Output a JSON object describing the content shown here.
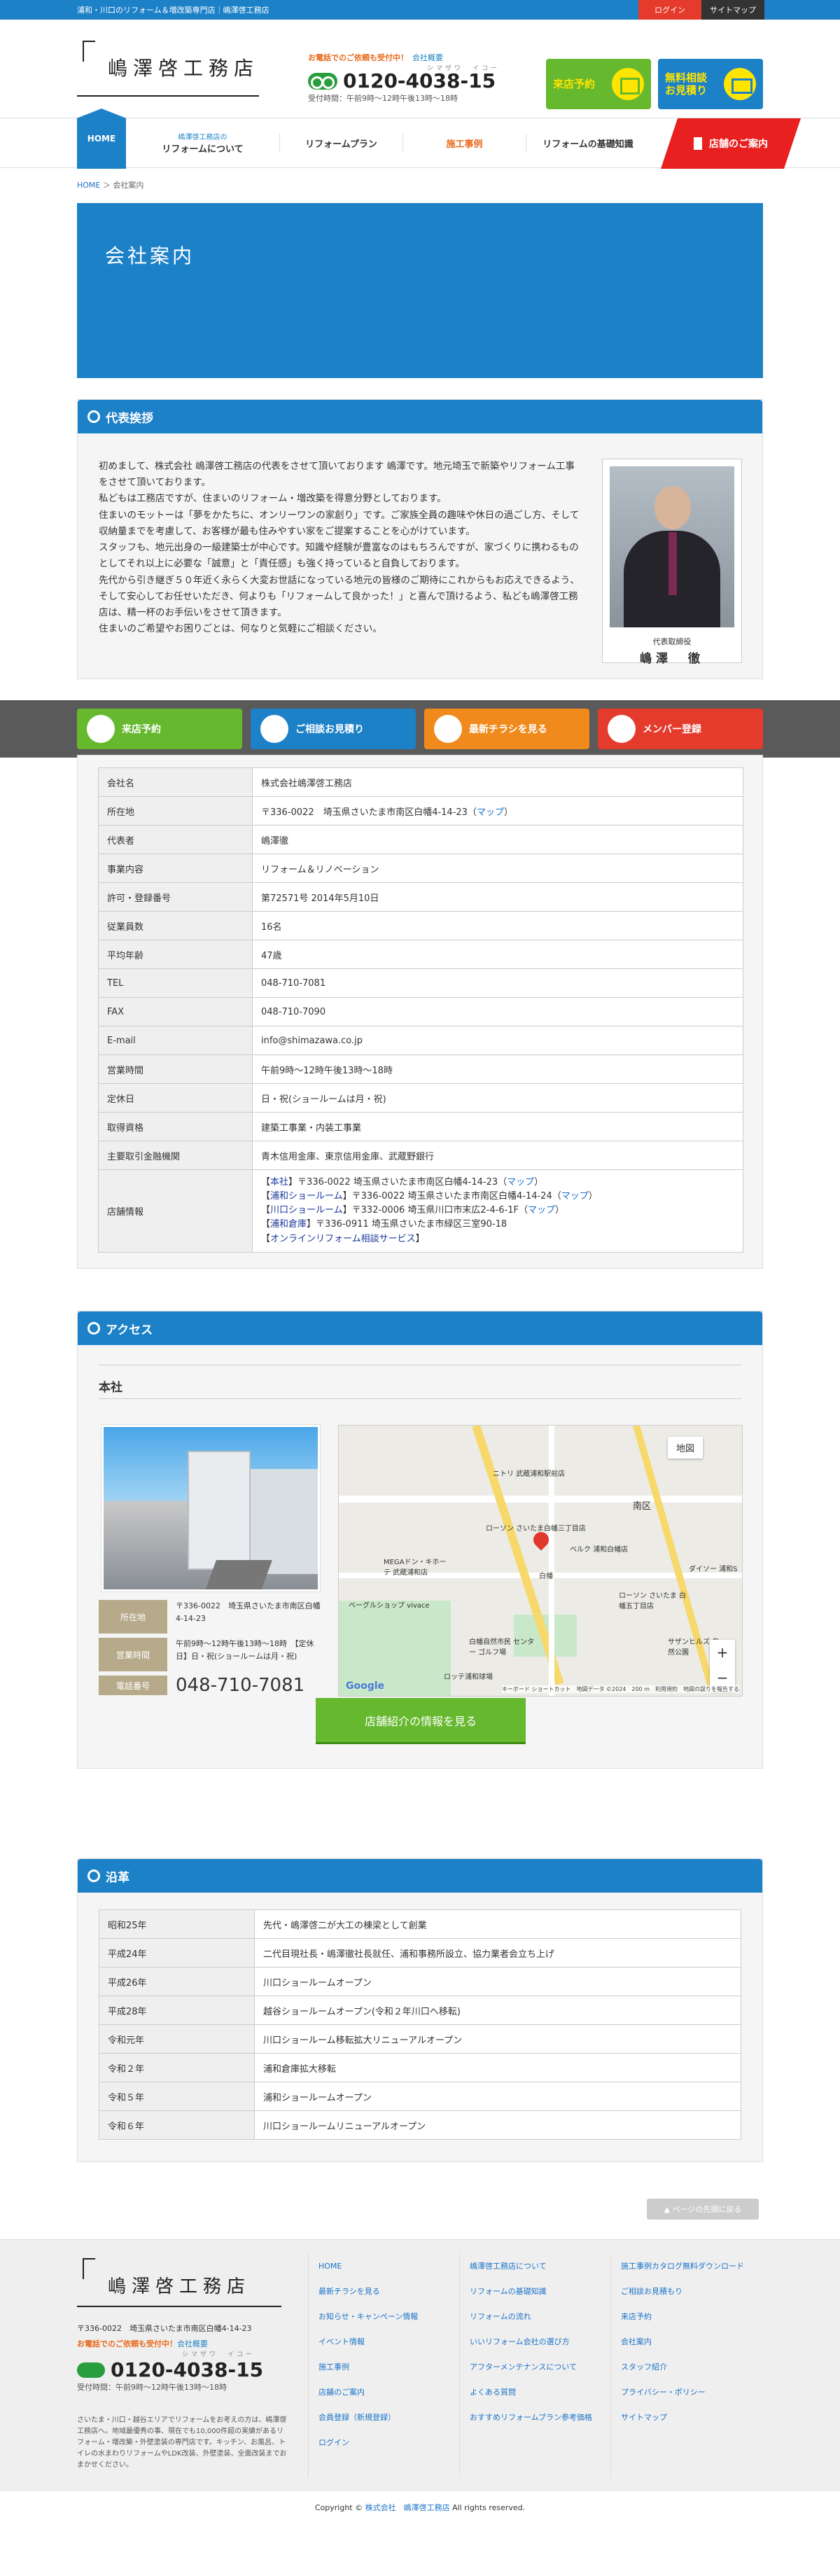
{
  "topbar": {
    "text": "浦和・川口のリフォーム＆増改築専門店｜嶋澤啓工務店",
    "login": "ログイン",
    "sitemap": "サイトマップ"
  },
  "header": {
    "logo": "嶋澤啓工務店",
    "phone_caption": "お電話でのご依頼も受付中！",
    "phone_sub": "会社概要",
    "phone_kana": "シマザワ　イコー",
    "phone_number": "0120-4038-15",
    "hours": "受付時間：午前9時〜12時午後13時〜18時",
    "btn_visit": "来店予約",
    "btn_est": "無料相談\nお見積り"
  },
  "nav": {
    "home": "HOME",
    "about_small": "嶋澤啓工務店の",
    "about": "リフォームについて",
    "plan": "リフォームプラン",
    "cases": "施工事例",
    "basics": "リフォームの基礎知識",
    "shop": "店舗のご案内"
  },
  "breadcrumb": {
    "home": "HOME",
    "sep": "＞",
    "current": "会社案内"
  },
  "page_title": "会社案内",
  "greeting": {
    "heading": "代表挨拶",
    "paragraphs": [
      "初めまして、株式会社 嶋澤啓工務店の代表をさせて頂いております 嶋澤です。地元埼玉で新築やリフォーム工事をさせて頂いております。",
      "私どもは工務店ですが、住まいのリフォーム・増改築を得意分野としております。",
      "住まいのモットーは「夢をかたちに、オンリーワンの家創り」です。ご家族全員の趣味や休日の過ごし方、そして収納量までを考慮して、お客様が最も住みやすい家をご提案することを心がけています。",
      "スタッフも、地元出身の一級建築士が中心です。知識や経験が豊富なのはもちろんですが、家づくりに携わるものとしてそれ以上に必要な「誠意」と「責任感」も強く持っていると自負しております。",
      "先代から引き継ぎ５０年近く永らく大変お世話になっている地元の皆様のご期待にこれからもお応えできるよう、そして安心してお任せいただき、何よりも「リフォームして良かった！」と喜んで頂けるよう、私ども嶋澤啓工務店は、精一杯のお手伝いをさせて頂きます。",
      "住まいのご希望やお困りごとは、何なりと気軽にご相談ください。"
    ],
    "role": "代表取締役",
    "name": "嶋澤　徹"
  },
  "band": {
    "visit": "来店予約",
    "consult": "ご相談お見積り",
    "flyer": "最新チラシを見る",
    "member": "メンバー登録"
  },
  "company": {
    "rows": [
      {
        "k": "会社名",
        "v": "株式会社嶋澤啓工務店"
      },
      {
        "k": "所在地",
        "v": "〒336-0022　埼玉県さいたま市南区白幡4-14-23（",
        "link": "マップ",
        "after": "）"
      },
      {
        "k": "代表者",
        "v": "嶋澤徹"
      },
      {
        "k": "事業内容",
        "v": "リフォーム＆リノベーション"
      },
      {
        "k": "許可・登録番号",
        "v": "第72571号 2014年5月10日"
      },
      {
        "k": "従業員数",
        "v": "16名"
      },
      {
        "k": "平均年齢",
        "v": "47歳"
      },
      {
        "k": "TEL",
        "v": "048-710-7081"
      },
      {
        "k": "FAX",
        "v": "048-710-7090"
      },
      {
        "k": "E-mail",
        "v": "info@shimazawa.co.jp"
      },
      {
        "k": "営業時間",
        "v": "午前9時〜12時午後13時〜18時"
      },
      {
        "k": "定休日",
        "v": "日・祝(ショールームは月・祝)"
      },
      {
        "k": "取得資格",
        "v": "建築工事業・内装工事業"
      },
      {
        "k": "主要取引金融機関",
        "v": "青木信用金庫、東京信用金庫、武蔵野銀行"
      }
    ],
    "shop_label": "店舗情報",
    "shops": [
      {
        "open": "【",
        "tag": "本社",
        "close": "】",
        "text": "〒336-0022 埼玉県さいたま市南区白幡4-14-23（",
        "link": "マップ",
        "end": "）"
      },
      {
        "open": "【",
        "tag": "浦和ショールーム",
        "close": "】",
        "text": "〒336-0022 埼玉県さいたま市南区白幡4-14-24（",
        "link": "マップ",
        "end": "）"
      },
      {
        "open": "【",
        "tag": "川口ショールーム",
        "close": "】",
        "text": "〒332-0006 埼玉県川口市末広2-4-6-1F（",
        "link": "マップ",
        "end": "）"
      },
      {
        "open": "【",
        "tag": "浦和倉庫",
        "close": "】",
        "text": "〒336-0911 埼玉県さいたま市緑区三室90-18",
        "link": "",
        "end": ""
      },
      {
        "open": "【",
        "tag": "オンラインリフォーム相談サービス",
        "close": "】",
        "text": "",
        "link": "",
        "end": ""
      }
    ]
  },
  "access": {
    "heading": "アクセス",
    "office": "本社",
    "addr_label": "所在地",
    "addr": "〒336-0022　埼玉県さいたま市南区白幡4-14-23",
    "hours_label": "営業時間",
    "hours": "午前9時〜12時午後13時〜18時　【定休日】日・祝(ショールームは月・祝)",
    "tel_label": "電話番号",
    "tel": "048-710-7081",
    "more": "店舗紹介の情報を見る",
    "map": {
      "type": "地図",
      "south": "南区",
      "shirahata": "白幡",
      "google": "Google",
      "attr": "キーボード ショートカット　地図データ ©2024　200 m　利用規約　地図の誤りを報告する",
      "l1": "ローソン さいたま白幡三丁目店",
      "l2": "ニトリ 武蔵浦和駅前店",
      "l3": "MEGAドン・キホーテ 武蔵浦和店",
      "l4": "ベルク 浦和白幡店",
      "l5": "ダイソー 浦和S",
      "l6": "ローソン さいたま 白幡五丁目店",
      "l7": "ベーグルショップ vivace",
      "l8": "サザンヒルズ 自然公園",
      "l9": "白幡自然市民 センター ゴルフ場",
      "l10": "ロッテ浦和球場"
    }
  },
  "history": {
    "heading": "沿革",
    "rows": [
      {
        "k": "昭和25年",
        "v": "先代・嶋澤啓二が大工の棟梁として創業"
      },
      {
        "k": "平成24年",
        "v": "二代目現社長・嶋澤徹社長就任、浦和事務所設立、協力業者会立ち上げ"
      },
      {
        "k": "平成26年",
        "v": "川口ショールームオープン"
      },
      {
        "k": "平成28年",
        "v": "越谷ショールームオープン(令和２年川口へ移転)"
      },
      {
        "k": "令和元年",
        "v": "川口ショールーム移転拡大リニューアルオープン"
      },
      {
        "k": "令和２年",
        "v": "浦和倉庫拡大移転"
      },
      {
        "k": "令和５年",
        "v": "浦和ショールームオープン"
      },
      {
        "k": "令和６年",
        "v": "川口ショールームリニューアルオープン"
      }
    ]
  },
  "pagetop": "▲ ページの先頭に戻る",
  "footer": {
    "logo": "嶋澤啓工務店",
    "addr": "〒336-0022　埼玉県さいたま市南区白幡4-14-23",
    "cap": "お電話でのご依頼も受付中！",
    "sub": "会社概要",
    "kana": "シマザワ　イコー",
    "num": "0120-4038-15",
    "hours": "受付時間：午前9時〜12時午後13時〜18時",
    "desc": "さいたま・川口・越谷エリアでリフォームをお考えの方は、嶋澤啓工務店へ。地域最優秀の事、現在でも10,000件超の実績があるリフォーム・増改築・外壁塗装の専門店です。キッチン、お風呂、トイレの水まわりリフォームやLDK改装、外壁塗装、全面改装までおまかせください。",
    "col1": [
      "HOME",
      "最新チラシを見る",
      "お知らせ・キャンペーン情報",
      "イベント情報",
      "施工事例",
      "店舗のご案内",
      "会員登録（新規登録）",
      "ログイン"
    ],
    "col2": [
      "嶋澤啓工務店について",
      "リフォームの基礎知識",
      "リフォームの流れ",
      "いいリフォーム会社の選び方",
      "アフターメンテナンスについて",
      "よくある質問",
      "おすすめリフォームプラン参考価格"
    ],
    "col3": [
      "施工事例カタログ無料ダウンロード",
      "ご相談お見積もり",
      "来店予約",
      "会社案内",
      "スタッフ紹介",
      "プライバシー・ポリシー",
      "サイトマップ"
    ]
  },
  "copyright": {
    "pre": "Copyright © ",
    "link": "株式会社　嶋澤啓工務店",
    "post": " All rights reserved."
  }
}
